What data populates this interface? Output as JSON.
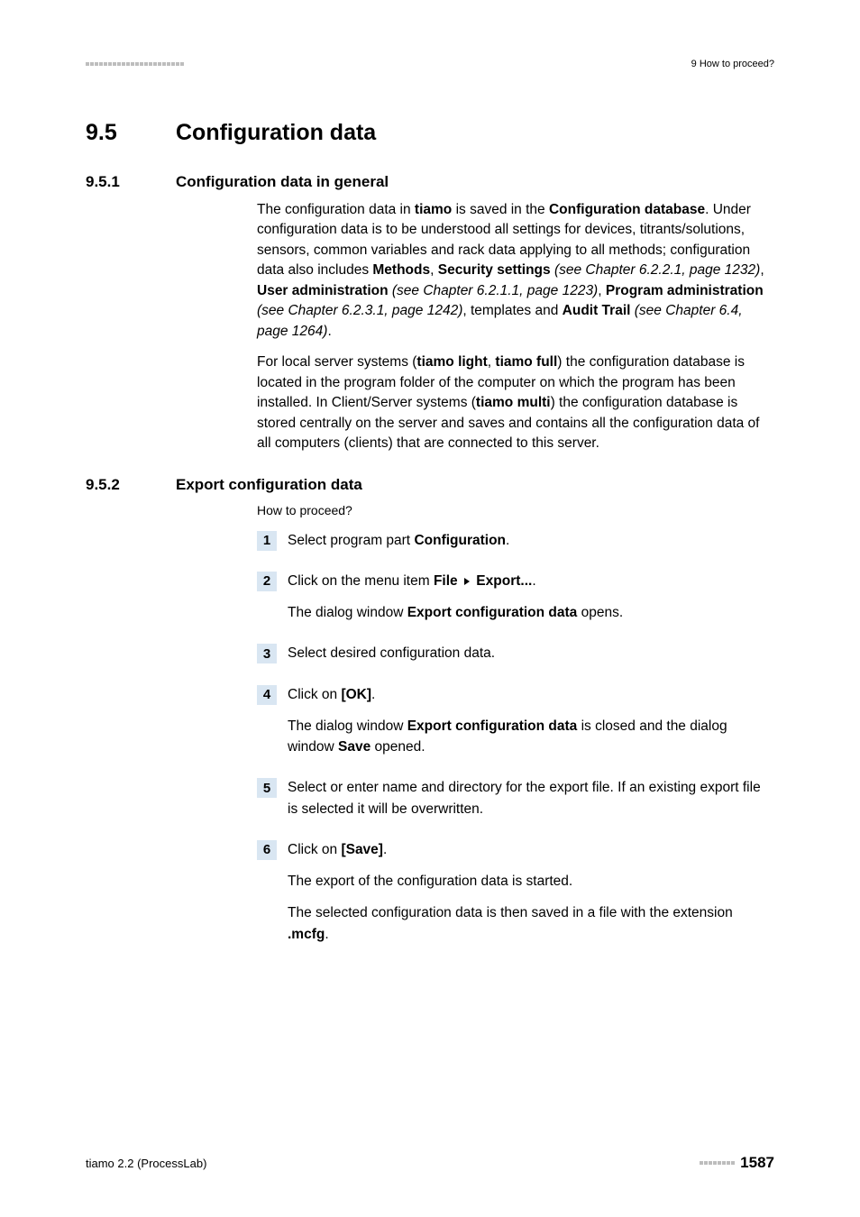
{
  "header": {
    "running_head": "9 How to proceed?"
  },
  "h1": {
    "num": "9.5",
    "title": "Configuration data"
  },
  "s1": {
    "num": "9.5.1",
    "title": "Configuration data in general",
    "p1_a": "The configuration data in ",
    "p1_b": "tiamo",
    "p1_c": " is saved in the ",
    "p1_d": "Configuration database",
    "p1_e": ". Under configuration data is to be understood all settings for devices, titrants/solutions, sensors, common variables and rack data applying to all methods; configuration data also includes ",
    "p1_f": "Methods",
    "p1_g": ", ",
    "p1_h": "Security settings",
    "p1_i": " (see Chapter 6.2.2.1, page 1232)",
    "p1_j": ", ",
    "p1_k": "User administration",
    "p1_l": " (see Chapter 6.2.1.1, page 1223)",
    "p1_m": ", ",
    "p1_n": "Program administration",
    "p1_o": " (see Chapter 6.2.3.1, page 1242)",
    "p1_p": ", templates and ",
    "p1_q": "Audit Trail",
    "p1_r": " (see Chapter 6.4, page 1264)",
    "p1_s": ".",
    "p2_a": "For local server systems (",
    "p2_b": "tiamo light",
    "p2_c": ", ",
    "p2_d": "tiamo full",
    "p2_e": ") the configuration database is located in the program folder of the computer on which the program has been installed. In Client/Server systems (",
    "p2_f": "tiamo multi",
    "p2_g": ") the configuration database is stored centrally on the server and saves and contains all the configuration data of all computers (clients) that are connected to this server."
  },
  "s2": {
    "num": "9.5.2",
    "title": "Export configuration data",
    "lead": "How to proceed?",
    "steps": {
      "n1": "1",
      "st1_a": "Select program part ",
      "st1_b": "Configuration",
      "st1_c": ".",
      "n2": "2",
      "st2_a": "Click on the menu item ",
      "st2_b": "File",
      "st2_c": "Export...",
      "st2_d": ".",
      "st2_e": "The dialog window ",
      "st2_f": "Export configuration data",
      "st2_g": " opens.",
      "n3": "3",
      "st3_a": "Select desired configuration data.",
      "n4": "4",
      "st4_a": "Click on ",
      "st4_b": "[OK]",
      "st4_c": ".",
      "st4_d": "The dialog window ",
      "st4_e": "Export configuration data",
      "st4_f": " is closed and the dialog window ",
      "st4_g": "Save",
      "st4_h": " opened.",
      "n5": "5",
      "st5_a": "Select or enter name and directory for the export file. If an existing export file is selected it will be overwritten.",
      "n6": "6",
      "st6_a": "Click on ",
      "st6_b": "[Save]",
      "st6_c": ".",
      "st6_d": "The export of the configuration data is started.",
      "st6_e": "The selected configuration data is then saved in a file with the extension ",
      "st6_f": ".mcfg",
      "st6_g": "."
    }
  },
  "footer": {
    "left": "tiamo 2.2 (ProcessLab)",
    "page": "1587"
  }
}
